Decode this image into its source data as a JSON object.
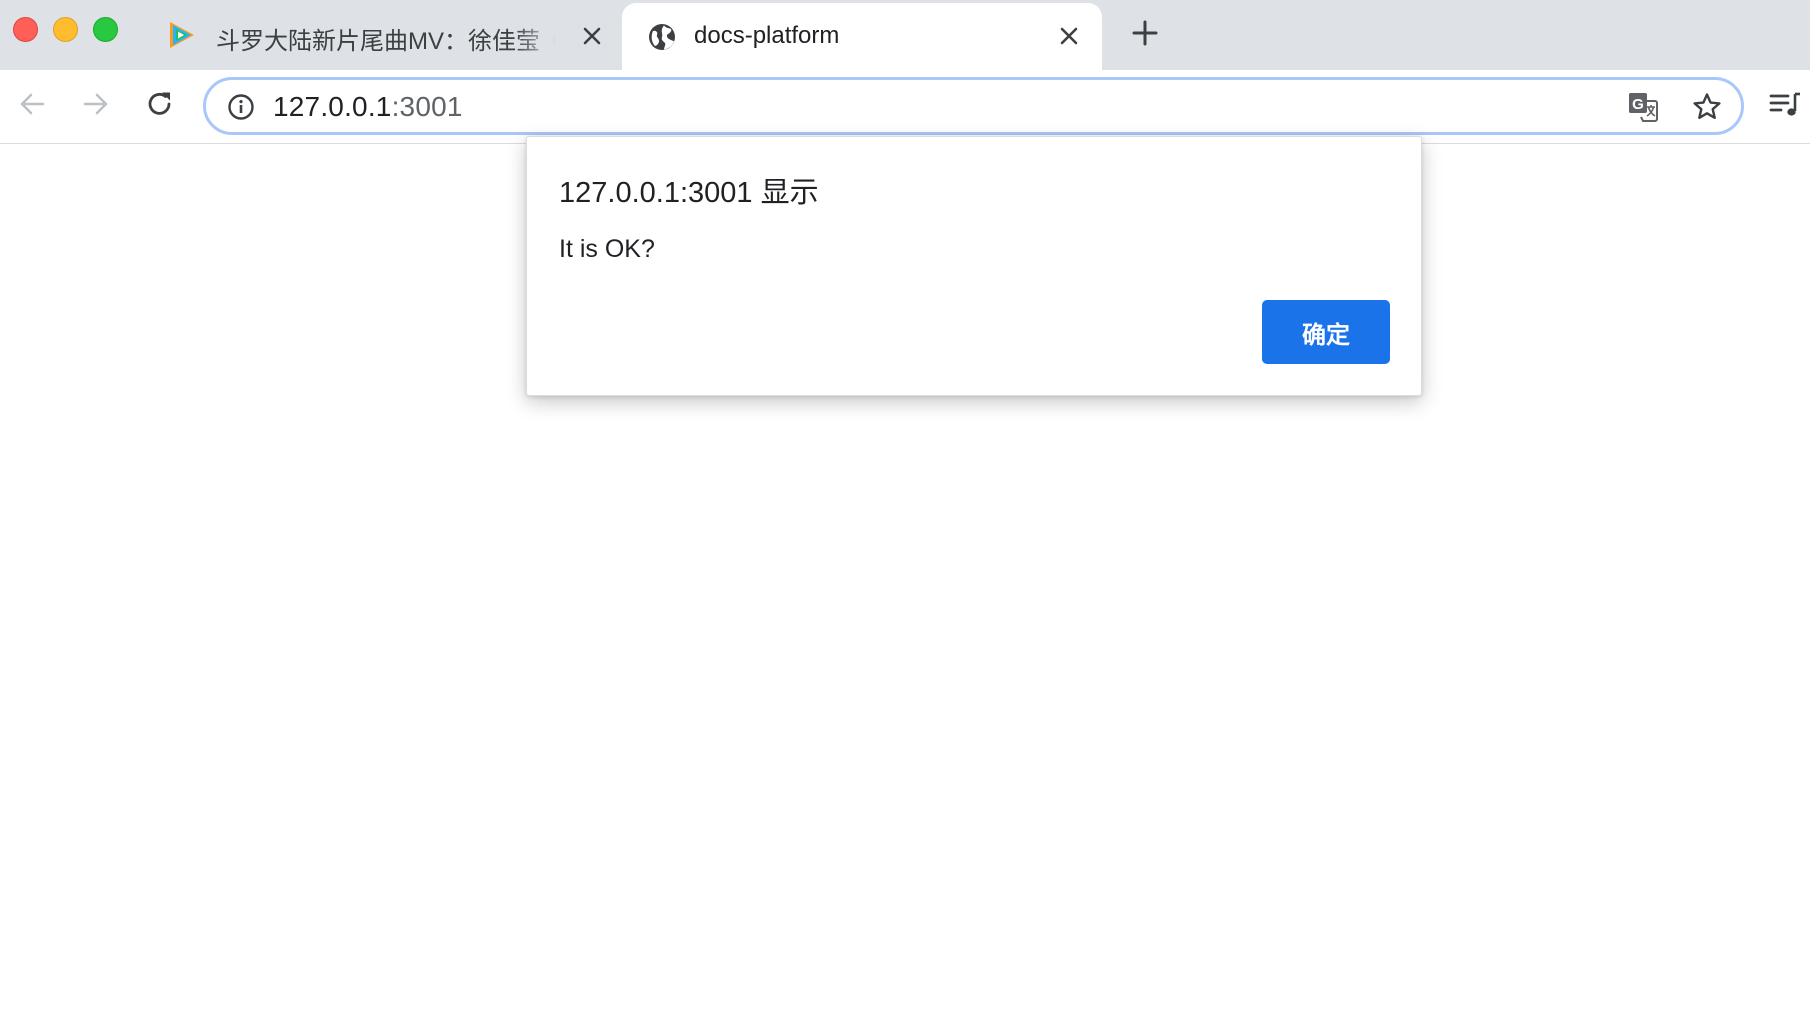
{
  "window": {
    "controls": {
      "close_icon": "close-traffic-light",
      "minimize_icon": "minimize-traffic-light",
      "maximize_icon": "maximize-traffic-light",
      "colors": {
        "close": "#ff5f57",
        "minimize": "#febc2e",
        "maximize": "#28c840"
      }
    }
  },
  "tabs": [
    {
      "title": "斗罗大陆新片尾曲MV：徐佳莹《",
      "favicon": "tencent-video-play-icon",
      "active": false
    },
    {
      "title": "docs-platform",
      "favicon": "globe-icon",
      "active": true
    }
  ],
  "new_tab_icon": "plus-icon",
  "toolbar": {
    "back_icon": "arrow-left-icon",
    "forward_icon": "arrow-right-icon",
    "reload_icon": "reload-icon",
    "omnibox": {
      "security_icon": "info-icon",
      "url_host": "127.0.0.1",
      "url_port": ":3001",
      "translate_icon": "translate-icon",
      "bookmark_icon": "star-icon"
    },
    "media_icon": "media-playlist-icon",
    "accent_color": "#a8c7fa"
  },
  "dialog": {
    "title": "127.0.0.1:3001 显示",
    "message": "It is OK?",
    "ok_label": "确定",
    "ok_color": "#1a73e8"
  }
}
